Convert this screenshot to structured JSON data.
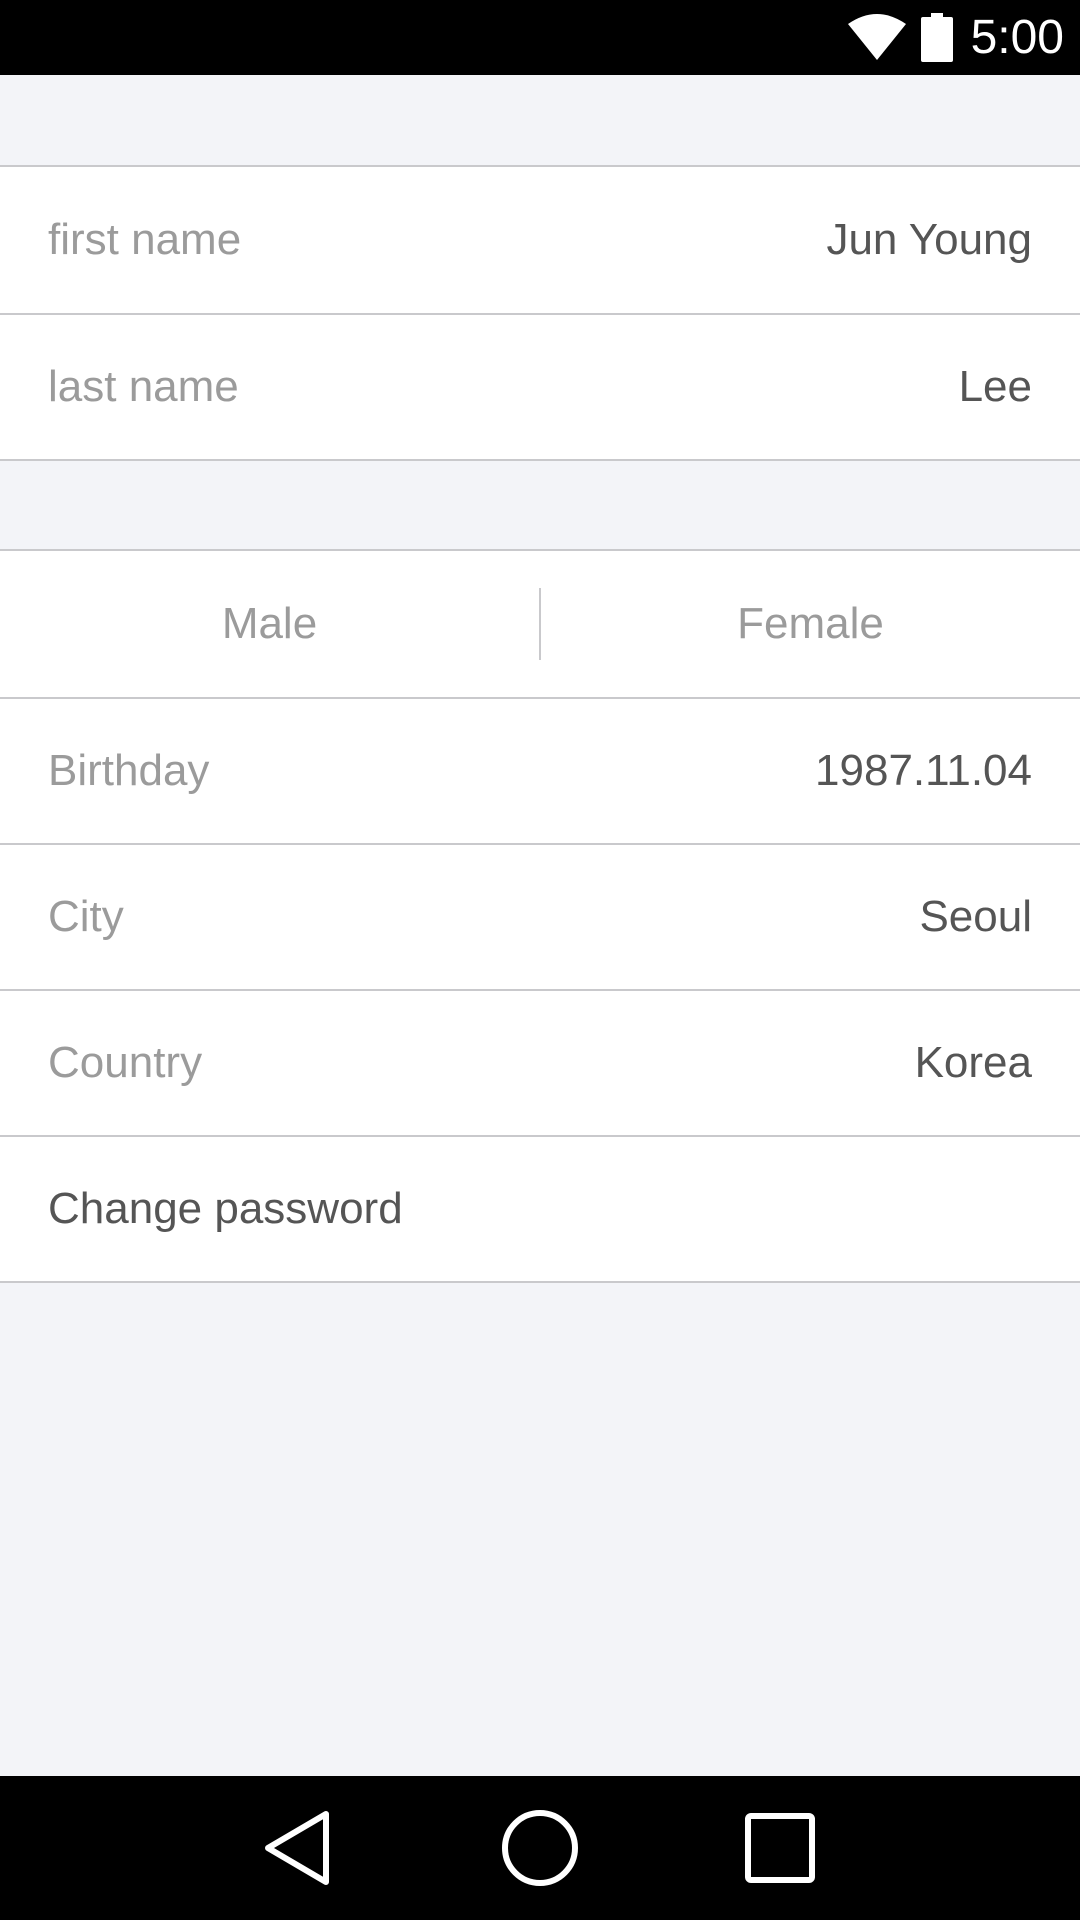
{
  "status_bar": {
    "time": "5:00",
    "icons": [
      "wifi-icon",
      "battery-icon"
    ]
  },
  "profile": {
    "first_name_label": "first name",
    "first_name_value": "Jun Young",
    "last_name_label": "last name",
    "last_name_value": "Lee"
  },
  "gender": {
    "options": [
      "Male",
      "Female"
    ]
  },
  "details": {
    "birthday_label": "Birthday",
    "birthday_value": "1987.11.04",
    "city_label": "City",
    "city_value": "Seoul",
    "country_label": "Country",
    "country_value": "Korea",
    "change_password_label": "Change password"
  },
  "navigation": {
    "icons": [
      "back-icon",
      "home-icon",
      "recent-apps-icon"
    ]
  },
  "colors": {
    "background": "#f3f4f8",
    "divider": "#c9c9cc",
    "label_text": "#9b9b9b",
    "value_text": "#555555"
  }
}
